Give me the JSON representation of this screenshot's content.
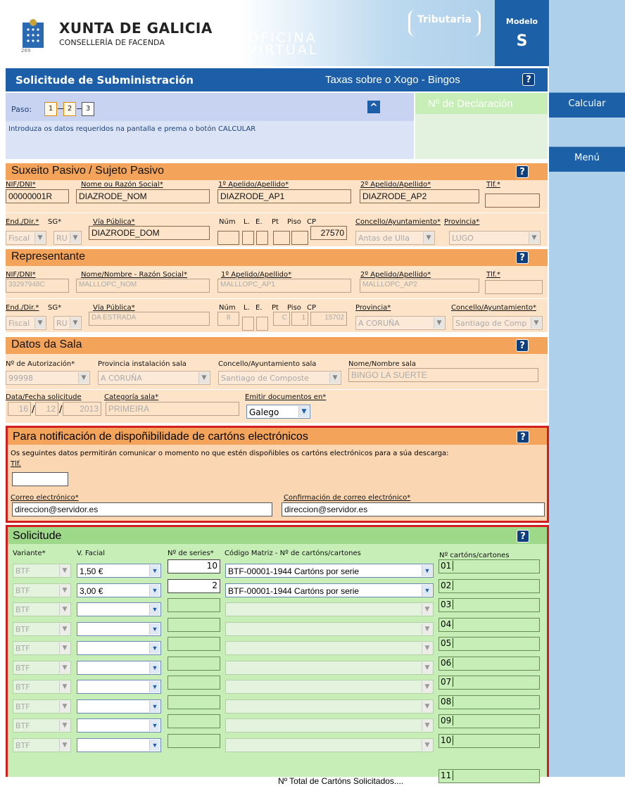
{
  "header": {
    "org": "XUNTA DE GALICIA",
    "dept": "CONSELLERÍA DE FACENDA",
    "logo_num": "269",
    "office_line1": "OFICINA",
    "office_line2": "VIRTUAL",
    "tributaria": "Tributaria",
    "modelo_label": "Modelo",
    "modelo_value": "S"
  },
  "side": {
    "calcular": "Calcular",
    "menu": "Menú"
  },
  "title": {
    "main": "Solicitude de Subministración",
    "sub": "Taxas sobre o Xogo - Bingos",
    "help": "?"
  },
  "paso": {
    "label": "Paso:",
    "steps": [
      "1",
      "2",
      "3"
    ],
    "instruction": "Introduza os datos requeridos na pantalla e prema o botón CALCULAR",
    "declaracion": "Nº de Declaración",
    "caret": "^"
  },
  "suxeito": {
    "title": "Suxeito Pasivo / Sujeto Pasivo",
    "labels": {
      "nif": "NIF/DNI*",
      "nome": "Nome ou Razón Social*",
      "ap1": "1º Apelido/Apellido*",
      "ap2": "2º Apelido/Apellido*",
      "tlf": "Tlf.*",
      "end": "End./Dir.*",
      "sg": "SG*",
      "via": "Vía Pública*",
      "num": "Núm",
      "l": "L.",
      "e": "E.",
      "pt": "Pt",
      "piso": "Piso",
      "cp": "CP",
      "concello": "Concello/Ayuntamiento*",
      "provincia": "Provincia*"
    },
    "values": {
      "nif": "00000001R",
      "nome": "DIAZRODE_NOM",
      "ap1": "DIAZRODE_AP1",
      "ap2": "DIAZRODE_AP2",
      "tlf": "",
      "end": "Fiscal",
      "sg": "RU",
      "via": "DIAZRODE_DOM",
      "cp": "27570",
      "concello": "Antas de Ulla",
      "provincia": "LUGO"
    }
  },
  "representante": {
    "title": "Representante",
    "labels": {
      "nif": "NIF/DNI*",
      "nome": "Nome/Nombre - Razón Social*",
      "ap1": "1º Apelido/Apellido*",
      "ap2": "2º Apelido/Apellido*",
      "tlf": "Tlf.*",
      "end": "End./Dir.*",
      "sg": "SG*",
      "via": "Vía Pública*",
      "num": "Núm",
      "l": "L.",
      "e": "E.",
      "pt": "Pt",
      "piso": "Piso",
      "cp": "CP",
      "provincia": "Provincia*",
      "concello": "Concello/Ayuntamiento*"
    },
    "values": {
      "nif": "33297948C",
      "nome": "MALLLOPC_NOM",
      "ap1": "MALLLOPC_AP1",
      "ap2": "MALLLOPC_AP2",
      "end": "Fiscal",
      "sg": "RU",
      "via": "DA ESTRADA",
      "num": "8",
      "pt": "C",
      "piso": "1",
      "cp": "15702",
      "provincia": "A CORUÑA",
      "concello": "Santiago de Comp"
    }
  },
  "sala": {
    "title": "Datos da Sala",
    "labels": {
      "aut": "Nº de Autorización*",
      "prov": "Provincia instalación sala",
      "concello": "Concello/Ayuntamiento sala",
      "nome": "Nome/Nombre sala",
      "data": "Data/Fecha solicitude",
      "cat": "Categoría sala*",
      "emitir": "Emitir documentos en*"
    },
    "values": {
      "aut": "99998",
      "prov": "A CORUÑA",
      "concello": "Santiago de Composte",
      "nome": "BINGO LA SUERTE",
      "dia": "16",
      "mes": "12",
      "ano": "2013",
      "cat": "PRIMEIRA",
      "emitir": "Galego"
    }
  },
  "notif": {
    "title": "Para notificación de dispoñibilidade de cartóns electrónicos",
    "desc": "Os seguintes datos permitirán comunicar o momento no que estén dispoñibles os cartóns electrónicos para a súa descarga:",
    "tlf_label": "Tlf.",
    "tlf_value": "",
    "email_label": "Correo electrónico*",
    "email_value": "direccion@servidor.es",
    "confirm_label": "Confirmación de correo electrónico*",
    "confirm_value": "direccion@servidor.es"
  },
  "solicitude": {
    "title": "Solicitude",
    "headers": {
      "variante": "Variante*",
      "facial": "V. Facial",
      "series": "Nº de series*",
      "codigo": "Código Matriz - Nº de cartóns/cartones",
      "ncart": "Nº cartóns/cartones"
    },
    "rows": [
      {
        "variante": "BTF",
        "facial": "1,50 €",
        "series": "10",
        "codigo": "BTF-00001-1944 Cartóns por serie",
        "num": "01"
      },
      {
        "variante": "BTF",
        "facial": "3,00 €",
        "series": "2",
        "codigo": "BTF-00001-1944 Cartóns por serie",
        "num": "02"
      },
      {
        "variante": "BTF",
        "facial": "",
        "series": "",
        "codigo": "",
        "num": "03"
      },
      {
        "variante": "BTF",
        "facial": "",
        "series": "",
        "codigo": "",
        "num": "04"
      },
      {
        "variante": "BTF",
        "facial": "",
        "series": "",
        "codigo": "",
        "num": "05"
      },
      {
        "variante": "BTF",
        "facial": "",
        "series": "",
        "codigo": "",
        "num": "06"
      },
      {
        "variante": "BTF",
        "facial": "",
        "series": "",
        "codigo": "",
        "num": "07"
      },
      {
        "variante": "BTF",
        "facial": "",
        "series": "",
        "codigo": "",
        "num": "08"
      },
      {
        "variante": "BTF",
        "facial": "",
        "series": "",
        "codigo": "",
        "num": "09"
      },
      {
        "variante": "BTF",
        "facial": "",
        "series": "",
        "codigo": "",
        "num": "10"
      }
    ],
    "total_label": "Nº Total de Cartóns Solicitados....",
    "total_num": "11"
  },
  "colors": {
    "primary": "#1c5fa8",
    "orange_header": "#f3a45a",
    "orange_bg": "#fde4c8",
    "green_bg": "#c6eeb6",
    "highlight": "#d31e1e"
  }
}
